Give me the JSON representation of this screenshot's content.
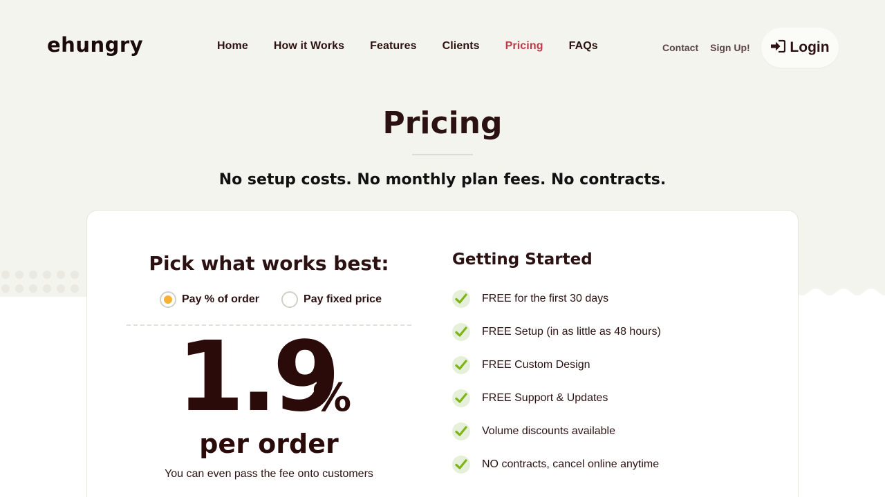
{
  "brand": {
    "logo_prefix": "eh",
    "logo_mid": "u",
    "logo_suffix": "ngry",
    "accent_color": "#c03a48",
    "dark_color": "#2b1111"
  },
  "nav": {
    "items": [
      {
        "label": "Home"
      },
      {
        "label": "How it Works"
      },
      {
        "label": "Features"
      },
      {
        "label": "Clients"
      },
      {
        "label": "Pricing",
        "active": true
      },
      {
        "label": "FAQs"
      }
    ],
    "contact": "Contact",
    "signup": "Sign Up!",
    "login": "Login"
  },
  "page": {
    "title": "Pricing",
    "subtitle": "No setup costs. No monthly plan fees. No contracts."
  },
  "pricing": {
    "heading": "Pick what works best:",
    "options": [
      {
        "label": "Pay % of order",
        "selected": true
      },
      {
        "label": "Pay fixed price",
        "selected": false
      }
    ],
    "rate_value": "1.9",
    "rate_unit": "%",
    "rate_label": "per order",
    "note": "You can even pass the fee onto customers"
  },
  "getting_started": {
    "heading": "Getting Started",
    "items": [
      "FREE for the first 30 days",
      "FREE Setup (in as little as 48 hours)",
      "FREE Custom Design",
      "FREE Support & Updates",
      "Volume discounts available",
      "NO contracts, cancel online anytime"
    ]
  },
  "icons": {
    "login": "sign-in-icon",
    "check": "check-icon",
    "radio_selected_color": "#f6b132",
    "check_color": "#7cb518"
  }
}
